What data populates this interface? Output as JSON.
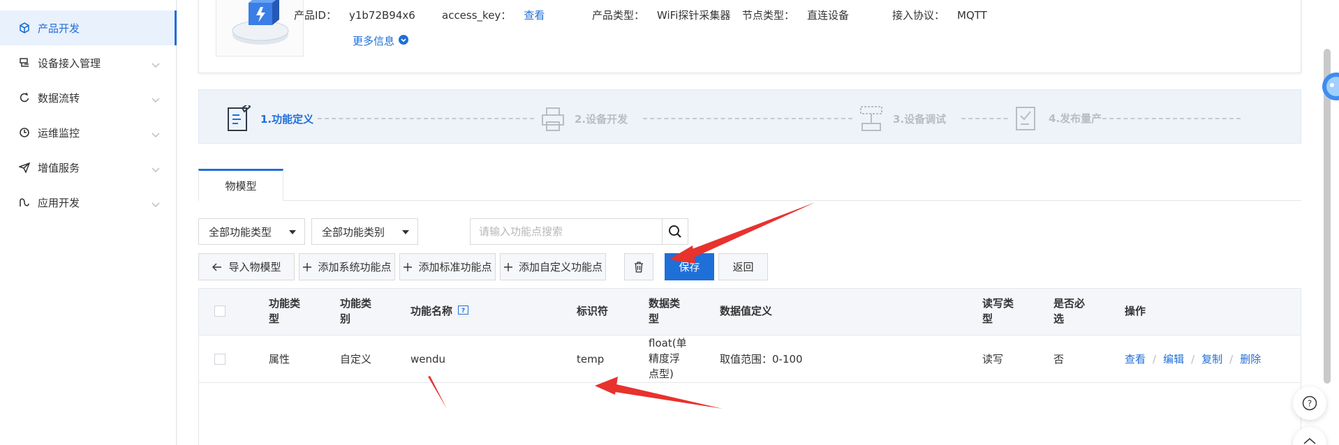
{
  "sidebar": {
    "items": [
      {
        "label": "产品开发",
        "icon": "cube-icon",
        "active": true
      },
      {
        "label": "设备接入管理",
        "icon": "device-icon"
      },
      {
        "label": "数据流转",
        "icon": "flow-icon"
      },
      {
        "label": "运维监控",
        "icon": "monitor-icon"
      },
      {
        "label": "增值服务",
        "icon": "send-icon"
      },
      {
        "label": "应用开发",
        "icon": "app-icon"
      }
    ]
  },
  "product": {
    "id_label": "产品ID：",
    "id_value": "y1b72B94x6",
    "key_label": "access_key：",
    "key_link": "查看",
    "type_label": "产品类型：",
    "type_value": "WiFi探针采集器",
    "node_label": "节点类型：",
    "node_value": "直连设备",
    "protocol_label": "接入协议：",
    "protocol_value": "MQTT",
    "more_info": "更多信息"
  },
  "steps": [
    {
      "label": "1.功能定义",
      "state": "active"
    },
    {
      "label": "2.设备开发",
      "state": "inactive"
    },
    {
      "label": "3.设备调试",
      "state": "inactive"
    },
    {
      "label": "4.发布量产",
      "state": "inactive"
    }
  ],
  "tabs": {
    "model": "物模型"
  },
  "filters": {
    "type_select": "全部功能类型",
    "category_select": "全部功能类别",
    "search_placeholder": "请输入功能点搜索"
  },
  "toolbar": {
    "import": "导入物模型",
    "add_system": "添加系统功能点",
    "add_standard": "添加标准功能点",
    "add_custom": "添加自定义功能点",
    "save": "保存",
    "back": "返回"
  },
  "table": {
    "headers": {
      "func_type_1": "功能类",
      "func_type_2": "型",
      "func_cat_1": "功能类",
      "func_cat_2": "别",
      "func_name": "功能名称",
      "identifier": "标识符",
      "data_type_1": "数据类",
      "data_type_2": "型",
      "data_def": "数据值定义",
      "rw_1": "读写类",
      "rw_2": "型",
      "required_1": "是否必",
      "required_2": "选",
      "ops": "操作"
    },
    "rows": [
      {
        "func_type": "属性",
        "func_cat": "自定义",
        "func_name": "wendu",
        "identifier": "temp",
        "data_type_1": "float(单",
        "data_type_2": "精度浮",
        "data_type_3": "点型)",
        "data_def": "取值范围：0-100",
        "rw": "读写",
        "required": "否",
        "op_view": "查看",
        "op_edit": "编辑",
        "op_copy": "复制",
        "op_delete": "删除"
      }
    ]
  },
  "colors": {
    "accent": "#1f6fd8",
    "annotation": "#e8322d"
  }
}
